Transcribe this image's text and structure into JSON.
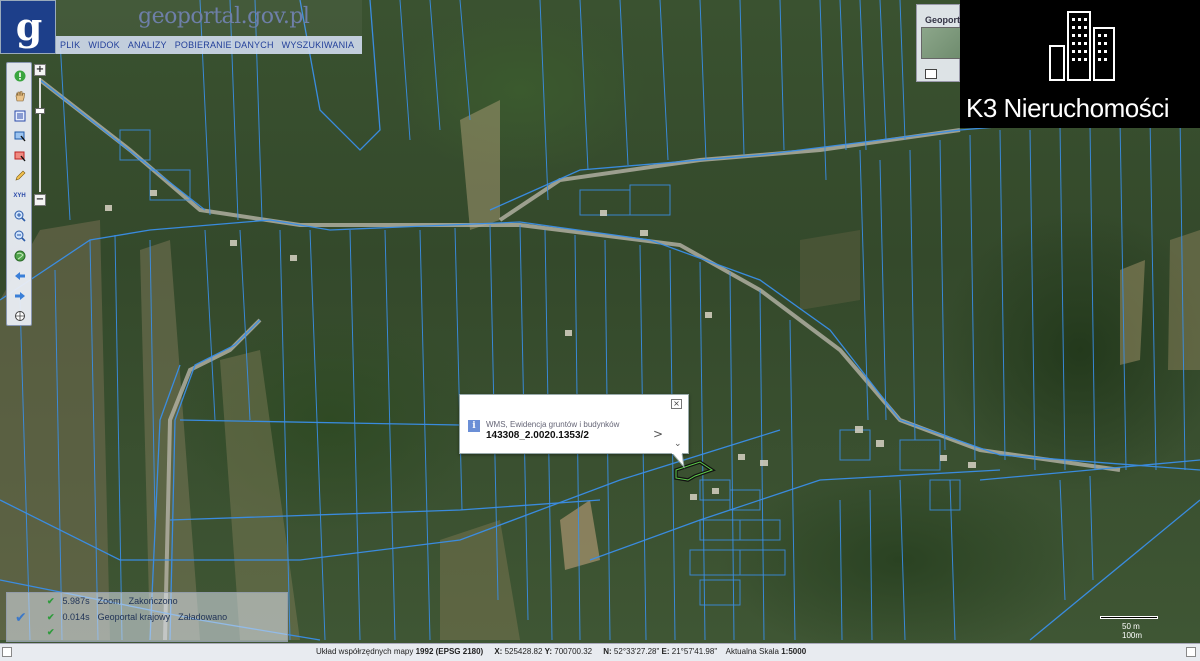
{
  "header": {
    "logo_letter": "g",
    "title": "geoportal.gov.pl",
    "menu": [
      "PLIK",
      "WIDOK",
      "ANALIZY",
      "POBIERANIE DANYCH",
      "WYSZUKIWANIA"
    ]
  },
  "toolbar": {
    "tools": [
      "info-icon",
      "hand-pan-icon",
      "layers-list-icon",
      "select-area-icon",
      "select-rect-icon",
      "pencil-icon",
      "xyh-icon",
      "zoom-in-icon",
      "zoom-out-icon",
      "globe-icon",
      "arrow-left-icon",
      "arrow-right-icon",
      "crosshair-icon"
    ],
    "xyh_label": "XYH",
    "zoom_plus": "+",
    "zoom_minus": "−"
  },
  "minimap": {
    "title": "Geoport"
  },
  "brand": {
    "name": "K3 Nieruchomości",
    "accent": "#000000"
  },
  "popup": {
    "layer": "WMS, Ewidencja gruntów i budynków",
    "value": "143308_2.0020.1353/2",
    "close_label": "×",
    "next_label": ">",
    "scroll_label": "⌄"
  },
  "status": {
    "rows": [
      {
        "time": "5.987s",
        "label": "Zoom",
        "state": "Zakończono"
      },
      {
        "time": "0.014s",
        "label": "Geoportal krajowy",
        "state": "Załadowano"
      },
      {
        "time": "",
        "label": "",
        "state": ""
      }
    ]
  },
  "scalebar": {
    "label": "50 m 100m"
  },
  "bottom": {
    "system_label": "Układ współrzędnych mapy",
    "system_value": "1992 (EPSG 2180)",
    "x_label": "X:",
    "x_value": "525428.82",
    "y_label": "Y:",
    "y_value": "700700.32",
    "n_label": "N:",
    "n_value": "52°33'27.28\"",
    "e_label": "E:",
    "e_value": "21°57'41.98\"",
    "scale_label": "Aktualna Skala",
    "scale_value": "1:5000"
  },
  "colors": {
    "parcel_lines": "#3a8fe8",
    "highlight": "#111111",
    "header_blue": "#1d3f8a"
  }
}
